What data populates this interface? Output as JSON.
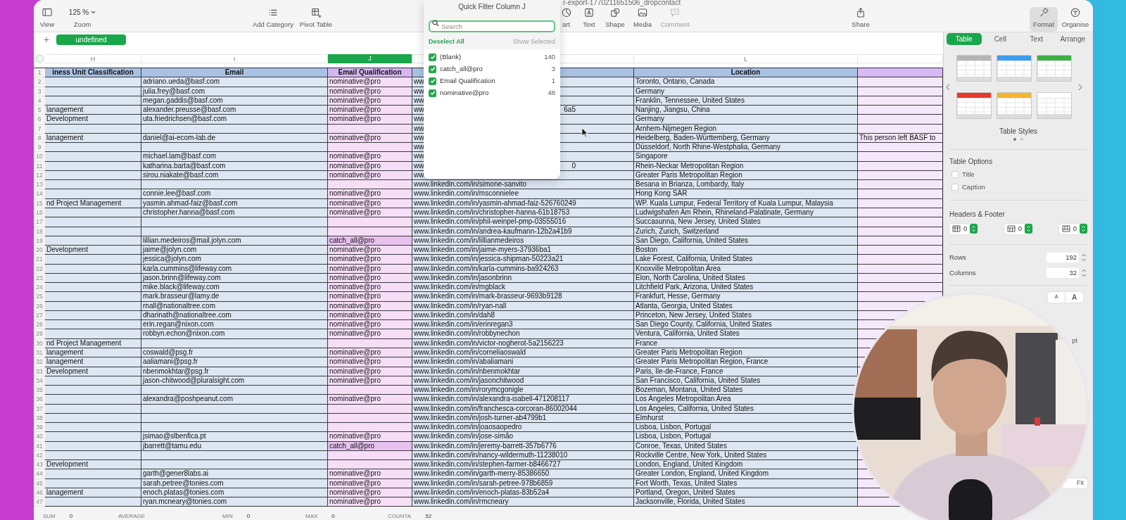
{
  "window": {
    "title": "r-export-1770211651506_dropcontact"
  },
  "toolbar": [
    {
      "kind": "button",
      "label": "View",
      "selected": false,
      "disabled": false
    },
    {
      "kind": "dropdown",
      "value": "125 %",
      "label": "Zoom",
      "selected": false,
      "disabled": false
    },
    {
      "kind": "button",
      "label": "Add Category",
      "selected": false,
      "disabled": false
    },
    {
      "kind": "button",
      "label": "Pivot Table",
      "selected": false,
      "disabled": false
    },
    {
      "kind": "button",
      "label": "art",
      "selected": false,
      "disabled": false
    },
    {
      "kind": "button",
      "label": "Text",
      "selected": false,
      "disabled": false
    },
    {
      "kind": "button",
      "label": "Shape",
      "selected": false,
      "disabled": false
    },
    {
      "kind": "button",
      "label": "Media",
      "selected": false,
      "disabled": false
    },
    {
      "kind": "button",
      "label": "Comment",
      "selected": false,
      "disabled": true
    },
    {
      "kind": "button",
      "label": "Share",
      "selected": false,
      "disabled": false
    },
    {
      "kind": "button",
      "label": "Format",
      "selected": true,
      "disabled": false
    },
    {
      "kind": "button",
      "label": "Organise",
      "selected": false,
      "disabled": false
    }
  ],
  "sheet_tabs": {
    "add": "+",
    "tabs": [
      {
        "label": "undefined",
        "selected": true
      }
    ]
  },
  "table": {
    "columns": [
      {
        "letter": "H",
        "selected": false
      },
      {
        "letter": "I",
        "selected": false
      },
      {
        "letter": "J",
        "selected": true
      },
      {
        "selected": false
      },
      {
        "letter": "L",
        "selected": false
      },
      {
        "selected": false
      }
    ],
    "header_row": {
      "number": "1",
      "h": "iness Unit Classification",
      "i": "Email",
      "j": "Email Qualification",
      "l": "Location"
    },
    "rows": [
      {
        "number": "2",
        "i": "adriano.ueda@basf.com",
        "j": "nominative@pro",
        "k": "ww",
        "l": "Toronto, Ontario, Canada",
        "highlighted": false
      },
      {
        "number": "3",
        "i": "julia.frey@basf.com",
        "j": "nominative@pro",
        "k": "ww",
        "l": "Germany",
        "highlighted": false
      },
      {
        "number": "4",
        "i": "megan.gaddis@basf.com",
        "j": "nominative@pro",
        "k": "ww",
        "l": "Franklin, Tennessee, United States",
        "highlighted": false
      },
      {
        "number": "5",
        "h": "lanagement",
        "i": "alexander.preusse@basf.com",
        "j": "nominative@pro",
        "k": "ww",
        "k_tail": "6a5",
        "l": "Nanjing, Jiangsu, China",
        "highlighted": false
      },
      {
        "number": "6",
        "h": "Development",
        "i": "uta.friedrichsen@basf.com",
        "j": "nominative@pro",
        "k": "ww",
        "l": "Germany",
        "highlighted": false
      },
      {
        "number": "7",
        "k": "ww",
        "l": "Arnhem-Nijmegen Region",
        "highlighted": false
      },
      {
        "number": "8",
        "h": "lanagement",
        "i": "daniel@ai-ecom-lab.de",
        "j": "nominative@pro",
        "k": "ww",
        "l": "Heidelberg, Baden-Württemberg, Germany",
        "m": "This person left BASF to",
        "highlighted": false
      },
      {
        "number": "9",
        "k": "ww",
        "l": "Düsseldorf, North Rhine-Westphalia, Germany",
        "highlighted": false
      },
      {
        "number": "10",
        "i": "michael.lam@basf.com",
        "j": "nominative@pro",
        "k": "ww",
        "l": "Singapore",
        "highlighted": false
      },
      {
        "number": "11",
        "i": "katharina.barta@basf.com",
        "j": "nominative@pro",
        "k": "ww",
        "k_tail": "0",
        "l": "Rhein-Neckar Metropolitan Region",
        "highlighted": false
      },
      {
        "number": "12",
        "i": "sirou.niakate@basf.com",
        "j": "nominative@pro",
        "k": "ww",
        "l": "Greater Paris Metropolitan Region",
        "highlighted": false
      },
      {
        "number": "13",
        "k": "www.linkedin.com/in/simone-sanvito",
        "l": "Besana in Brianza, Lombardy, Italy",
        "highlighted": false
      },
      {
        "number": "14",
        "i": "connie.lee@basf.com",
        "j": "nominative@pro",
        "k": "www.linkedin.com/in/msconnielee",
        "l": "Hong Kong SAR",
        "highlighted": false
      },
      {
        "number": "15",
        "h": "nd Project Management",
        "i": "yasmin.ahmad-faiz@basf.com",
        "j": "nominative@pro",
        "k": "www.linkedin.com/in/yasmin-ahmad-faiz-526760249",
        "l": "WP. Kuala Lumpur, Federal Territory of Kuala Lumpur, Malaysia",
        "highlighted": false
      },
      {
        "number": "16",
        "i": "christopher.hanna@basf.com",
        "j": "nominative@pro",
        "k": "www.linkedin.com/in/christopher-hanna-61b18753",
        "l": "Ludwigshafen Am Rhein, Rhineland-Palatinate, Germany",
        "highlighted": false
      },
      {
        "number": "17",
        "k": "www.linkedin.com/in/phil-weinpel-pmp-03555016",
        "l": "Succasunna, New Jersey, United States",
        "highlighted": false
      },
      {
        "number": "18",
        "k": "www.linkedin.com/in/andrea-kaufmann-12b2a41b9",
        "l": "Zurich, Zurich, Switzerland",
        "highlighted": false
      },
      {
        "number": "19",
        "i": "lillian.medeiros@mail.jolyn.com",
        "j": "catch_all@pro",
        "k": "www.linkedin.com/in/lillianmedeiros",
        "l": "San Diego, California, United States",
        "highlighted": true
      },
      {
        "number": "20",
        "h": "Development",
        "i": "jaime@jolyn.com",
        "j": "nominative@pro",
        "k": "www.linkedin.com/in/jaime-myers-37936ba1",
        "l": "Boston",
        "highlighted": false
      },
      {
        "number": "21",
        "i": "jessica@jolyn.com",
        "j": "nominative@pro",
        "k": "www.linkedin.com/in/jessica-shipman-50223a21",
        "l": "Lake Forest, California, United States",
        "highlighted": false
      },
      {
        "number": "22",
        "i": "karla.cummins@lifeway.com",
        "j": "nominative@pro",
        "k": "www.linkedin.com/in/karla-cummins-ba924263",
        "l": "Knoxville Metropolitan Area",
        "highlighted": false
      },
      {
        "number": "23",
        "i": "jason.brinn@lifeway.com",
        "j": "nominative@pro",
        "k": "www.linkedin.com/in/jasonbrinn",
        "l": "Elon, North Carolina, United States",
        "highlighted": false
      },
      {
        "number": "24",
        "i": "mike.black@lifeway.com",
        "j": "nominative@pro",
        "k": "www.linkedin.com/in/mgblack",
        "l": "Litchfield Park, Arizona, United States",
        "highlighted": false
      },
      {
        "number": "25",
        "i": "mark.brasseur@lamy.de",
        "j": "nominative@pro",
        "k": "www.linkedin.com/in/mark-brasseur-9693b9128",
        "l": "Frankfurt, Hesse, Germany",
        "highlighted": false
      },
      {
        "number": "26",
        "i": "rnall@nationaltree.com",
        "j": "nominative@pro",
        "k": "www.linkedin.com/in/ryan-nall",
        "l": "Atlanta, Georgia, United States",
        "highlighted": false
      },
      {
        "number": "27",
        "i": "dharinath@nationaltree.com",
        "j": "nominative@pro",
        "k": "www.linkedin.com/in/dah8",
        "l": "Princeton, New Jersey, United States",
        "highlighted": false
      },
      {
        "number": "28",
        "i": "erin.regan@nixon.com",
        "j": "nominative@pro",
        "k": "www.linkedin.com/in/erinregan3",
        "l": "San Diego County, California, United States",
        "highlighted": false
      },
      {
        "number": "29",
        "i": "robbyn.echon@nixon.com",
        "j": "nominative@pro",
        "k": "www.linkedin.com/in/robbynechon",
        "l": "Ventura, California, United States",
        "highlighted": false
      },
      {
        "number": "30",
        "h": "nd Project Management",
        "k": "www.linkedin.com/in/victor-nogherot-5a2156223",
        "l": "France",
        "highlighted": false
      },
      {
        "number": "31",
        "h": "lanagement",
        "i": "coswald@psg.fr",
        "j": "nominative@pro",
        "k": "www.linkedin.com/in/corneliaoswald",
        "l": "Greater Paris Metropolitan Region",
        "highlighted": false
      },
      {
        "number": "32",
        "h": "lanagement",
        "i": "aaliamani@psg.fr",
        "j": "nominative@pro",
        "k": "www.linkedin.com/in/abaliamani",
        "l": "Greater Paris Metropolitan Region, France",
        "highlighted": false
      },
      {
        "number": "33",
        "h": "Development",
        "i": "nbenmokhtar@psg.fr",
        "j": "nominative@pro",
        "k": "www.linkedin.com/in/nbenmokhtar",
        "l": "Paris, Ile-de-France, France",
        "highlighted": false
      },
      {
        "number": "34",
        "i": "jason-chitwood@pluralsight.com",
        "j": "nominative@pro",
        "k": "www.linkedin.com/in/jasonchitwood",
        "l": "San Francisco, California, United States",
        "highlighted": false
      },
      {
        "number": "35",
        "k": "www.linkedin.com/in/rorymcgonigle",
        "l": "Bozeman, Montana, United States",
        "highlighted": false
      },
      {
        "number": "36",
        "i": "alexandra@poshpeanut.com",
        "j": "nominative@pro",
        "k": "www.linkedin.com/in/alexandra-isabell-471208117",
        "l": "Los Angeles Metropolitan Area",
        "highlighted": false
      },
      {
        "number": "37",
        "k": "www.linkedin.com/in/franchesca-corcoran-86002044",
        "l": "Los Angeles, California, United States",
        "highlighted": false
      },
      {
        "number": "38",
        "k": "www.linkedin.com/in/josh-turner-ab4799b1",
        "l": "Elmhurst",
        "highlighted": false
      },
      {
        "number": "39",
        "k": "www.linkedin.com/in/joaosaopedro",
        "l": "Lisboa, Lisbon, Portugal",
        "highlighted": false
      },
      {
        "number": "40",
        "i": "jsimao@slbenfica.pt",
        "j": "nominative@pro",
        "k": "www.linkedin.com/in/jose-simão",
        "l": "Lisboa, Lisbon, Portugal",
        "highlighted": false
      },
      {
        "number": "41",
        "i": "jbarrett@tamu.edu",
        "j": "catch_all@pro",
        "k": "www.linkedin.com/in/jeremy-barrett-357b6776",
        "l": "Conroe, Texas, United States",
        "highlighted": true
      },
      {
        "number": "42",
        "k": "www.linkedin.com/in/nancy-wildermuth-11238010",
        "l": "Rockville Centre, New York, United States",
        "highlighted": false
      },
      {
        "number": "43",
        "h": "Development",
        "k": "www.linkedin.com/in/stephen-farmer-b8466727",
        "l": "London, England, United Kingdom",
        "highlighted": false
      },
      {
        "number": "44",
        "i": "garth@gener8labs.ai",
        "j": "nominative@pro",
        "k": "www.linkedin.com/in/garth-merry-85386650",
        "l": "Greater London, England, United Kingdom",
        "highlighted": false
      },
      {
        "number": "45",
        "i": "sarah.petree@tonies.com",
        "j": "nominative@pro",
        "k": "www.linkedin.com/in/sarah-petree-978b6859",
        "l": "Fort Worth, Texas, United States",
        "highlighted": false
      },
      {
        "number": "46",
        "h": "lanagement",
        "i": "enoch.platas@tonies.com",
        "j": "nominative@pro",
        "k": "www.linkedin.com/in/enoch-platas-83b52a4",
        "l": "Portland, Oregon, United States",
        "highlighted": false
      },
      {
        "number": "47",
        "i": "ryan.mcneary@tonies.com",
        "j": "nominative@pro",
        "k": "www.linkedin.com/in/rmcneary",
        "l": "Jacksonville, Florida, United States",
        "highlighted": false
      }
    ]
  },
  "quick_filter": {
    "title": "Quick Filter Column J",
    "search": {
      "placeholder": "Search"
    },
    "deselect_all": "Deselect All",
    "show_selected": {
      "label": "Show Selected",
      "disabled": true
    },
    "items": [
      {
        "label": "(Blank)",
        "count": "140",
        "checked": true
      },
      {
        "label": "catch_all@pro",
        "count": "3",
        "checked": true
      },
      {
        "label": "Email Qualification",
        "count": "1",
        "checked": true
      },
      {
        "label": "nominative@pro",
        "count": "48",
        "checked": true
      }
    ]
  },
  "sidebar": {
    "tabs": [
      {
        "label": "Table",
        "selected": true
      },
      {
        "label": "Cell",
        "selected": false
      },
      {
        "label": "Text",
        "selected": false
      },
      {
        "label": "Arrange",
        "selected": false
      }
    ],
    "table_styles": {
      "title": "Table Styles",
      "styles": [
        {
          "color": "#b4b4b4"
        },
        {
          "color": "#3d9cf0"
        },
        {
          "color": "#3cb043"
        },
        {
          "color": "#e8382c"
        },
        {
          "color": "#f5b52e"
        },
        {
          "color": "#ffffff"
        }
      ],
      "pages": [
        {
          "selected": true
        },
        {
          "selected": false
        }
      ]
    },
    "table_options": {
      "title": "Table Options",
      "options": [
        {
          "label": "Title",
          "checked": false
        },
        {
          "label": "Caption",
          "checked": false
        }
      ]
    },
    "headers_footer": {
      "title": "Headers & Footer",
      "steppers": [
        {
          "kind": "header_rows",
          "value": "0"
        },
        {
          "kind": "header_columns",
          "value": "0"
        },
        {
          "kind": "footer_rows",
          "value": "0"
        }
      ]
    },
    "fields": [
      {
        "label": "Rows",
        "value": "192"
      },
      {
        "label": "Columns",
        "value": "32"
      }
    ],
    "font_buttons": [
      "A",
      "A"
    ],
    "size_unit": "pt",
    "fit_button": "Fit"
  },
  "status_bar": [
    {
      "label": "SUM",
      "value": "0"
    },
    {
      "label": "AVERAGE"
    },
    {
      "label": "MIN",
      "value": "0"
    },
    {
      "label": "MAX",
      "value": "0"
    },
    {
      "label": "COUNTA",
      "value": "52"
    }
  ]
}
